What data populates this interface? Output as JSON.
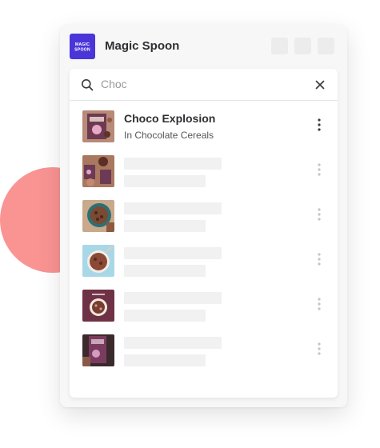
{
  "app": {
    "logo_text": "MAGIC SPOON",
    "title": "Magic Spoon",
    "accent": "#4a36d8"
  },
  "search": {
    "value": "",
    "placeholder": "Choc"
  },
  "results": [
    {
      "title": "Choco Explosion",
      "subtitle": "In Chocolate Cereals",
      "loaded": true
    },
    {
      "loaded": false
    },
    {
      "loaded": false
    },
    {
      "loaded": false
    },
    {
      "loaded": false
    },
    {
      "loaded": false
    }
  ],
  "icons": [
    "search-icon",
    "close-icon",
    "more-vertical-icon"
  ],
  "background_accent": "#f99493"
}
